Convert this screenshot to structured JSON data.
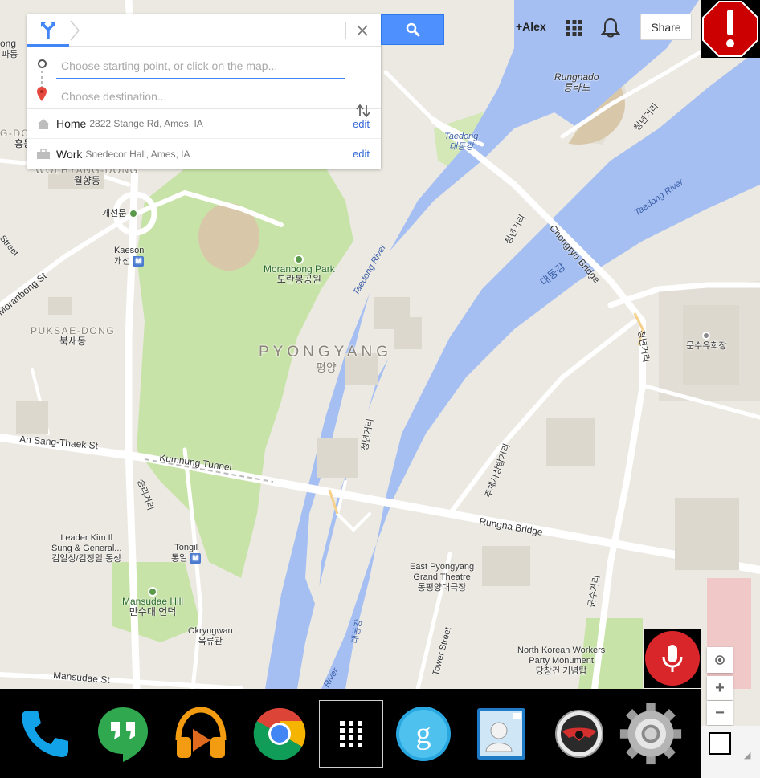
{
  "directions": {
    "start_placeholder": "Choose starting point, or click on the map...",
    "destination_placeholder": "Choose destination...",
    "saved_places": [
      {
        "name": "Home",
        "address": "2822 Stange Rd, Ames, IA",
        "edit_label": "edit",
        "icon": "home-icon"
      },
      {
        "name": "Work",
        "address": "Snedecor Hall, Ames, IA",
        "edit_label": "edit",
        "icon": "work-icon"
      }
    ]
  },
  "header": {
    "user": "+Alex",
    "share_label": "Share"
  },
  "map_labels": {
    "rungnado_en": "Rungnado",
    "rungnado_ko": "릉라도",
    "chongnyon_road": "청년거리",
    "taedong_en": "Taedong",
    "taedong_ko": "대동강",
    "taedong_river_1": "Taedong River",
    "taedong_river_2": "Taedong River",
    "wolhyang_en": "WOLHYANG-DONG",
    "wolhyang_ko": "월향동",
    "gaeseonmun": "개선문",
    "kaeson_en": "Kaeson",
    "kaeson_ko": "개선",
    "moranbong_park_en": "Moranbong Park",
    "moranbong_park_ko": "모란봉공원",
    "moranbong_st": "Moranbong St",
    "puksae_en": "PUKSAE-DONG",
    "puksae_ko": "북새동",
    "pyongyang_en": "PYONGYANG",
    "pyongyang_ko": "평양",
    "chongryu_bridge": "Chongryu Bridge",
    "daedong_ko": "대동강",
    "munsu_center": "문수유희장",
    "chongnyon_road_2": "청년거리",
    "chongnyon_road_3": "청년거리",
    "an_sang_thaek": "An Sang-Thaek St",
    "kumnung_tunnel": "Kumnung Tunnel",
    "sungri_road": "승리거리",
    "juche_road": "주체사상탑거리",
    "rungna_bridge": "Rungna Bridge",
    "leader_kim_1": "Leader Kim Il",
    "leader_kim_2": "Sung & General...",
    "leader_kim_ko": "김일성/김정일 동상",
    "tongil_en": "Tongil",
    "tongil_ko": "통일",
    "east_py_1": "East Pyongyang",
    "east_py_2": "Grand Theatre",
    "east_py_ko": "동평양대극장",
    "munsu_road": "문수거리",
    "mansudae_hill_en": "Mansudae Hill",
    "mansudae_hill_ko": "만수대 언덕",
    "okryugwan_en": "Okryugwan",
    "okryugwan_ko": "옥류관",
    "daedong_ko_2": "대동강",
    "nkw_party_1": "North Korean Workers",
    "nkw_party_2": "Party Monument",
    "nkw_party_ko": "당창건 기념탑",
    "tower_street": "Tower Street",
    "mansudae_st": "Mansudae St",
    "river_bottom": "River",
    "padong": "파동",
    "g_dong": "G-DONG",
    "hungdong": "흥동",
    "street_left": "Street",
    "jong": "ong"
  },
  "map_controls": {
    "zoom_in": "+",
    "zoom_out": "−"
  },
  "dock_apps": [
    {
      "name": "phone",
      "icon": "phone-icon"
    },
    {
      "name": "hangouts",
      "icon": "hangouts-icon"
    },
    {
      "name": "play-music",
      "icon": "headphones-icon"
    },
    {
      "name": "chrome",
      "icon": "chrome-icon"
    },
    {
      "name": "app-drawer",
      "icon": "grid-icon"
    },
    {
      "name": "google-search",
      "icon": "google-icon"
    },
    {
      "name": "contacts",
      "icon": "contact-card-icon"
    },
    {
      "name": "car-home",
      "icon": "steering-wheel-icon"
    },
    {
      "name": "settings",
      "icon": "gear-icon"
    }
  ],
  "colors": {
    "water": "#a5bff3",
    "park": "#c8e3a8",
    "land": "#ece9e2",
    "accent": "#4d90fe",
    "alert": "#cc0000"
  }
}
